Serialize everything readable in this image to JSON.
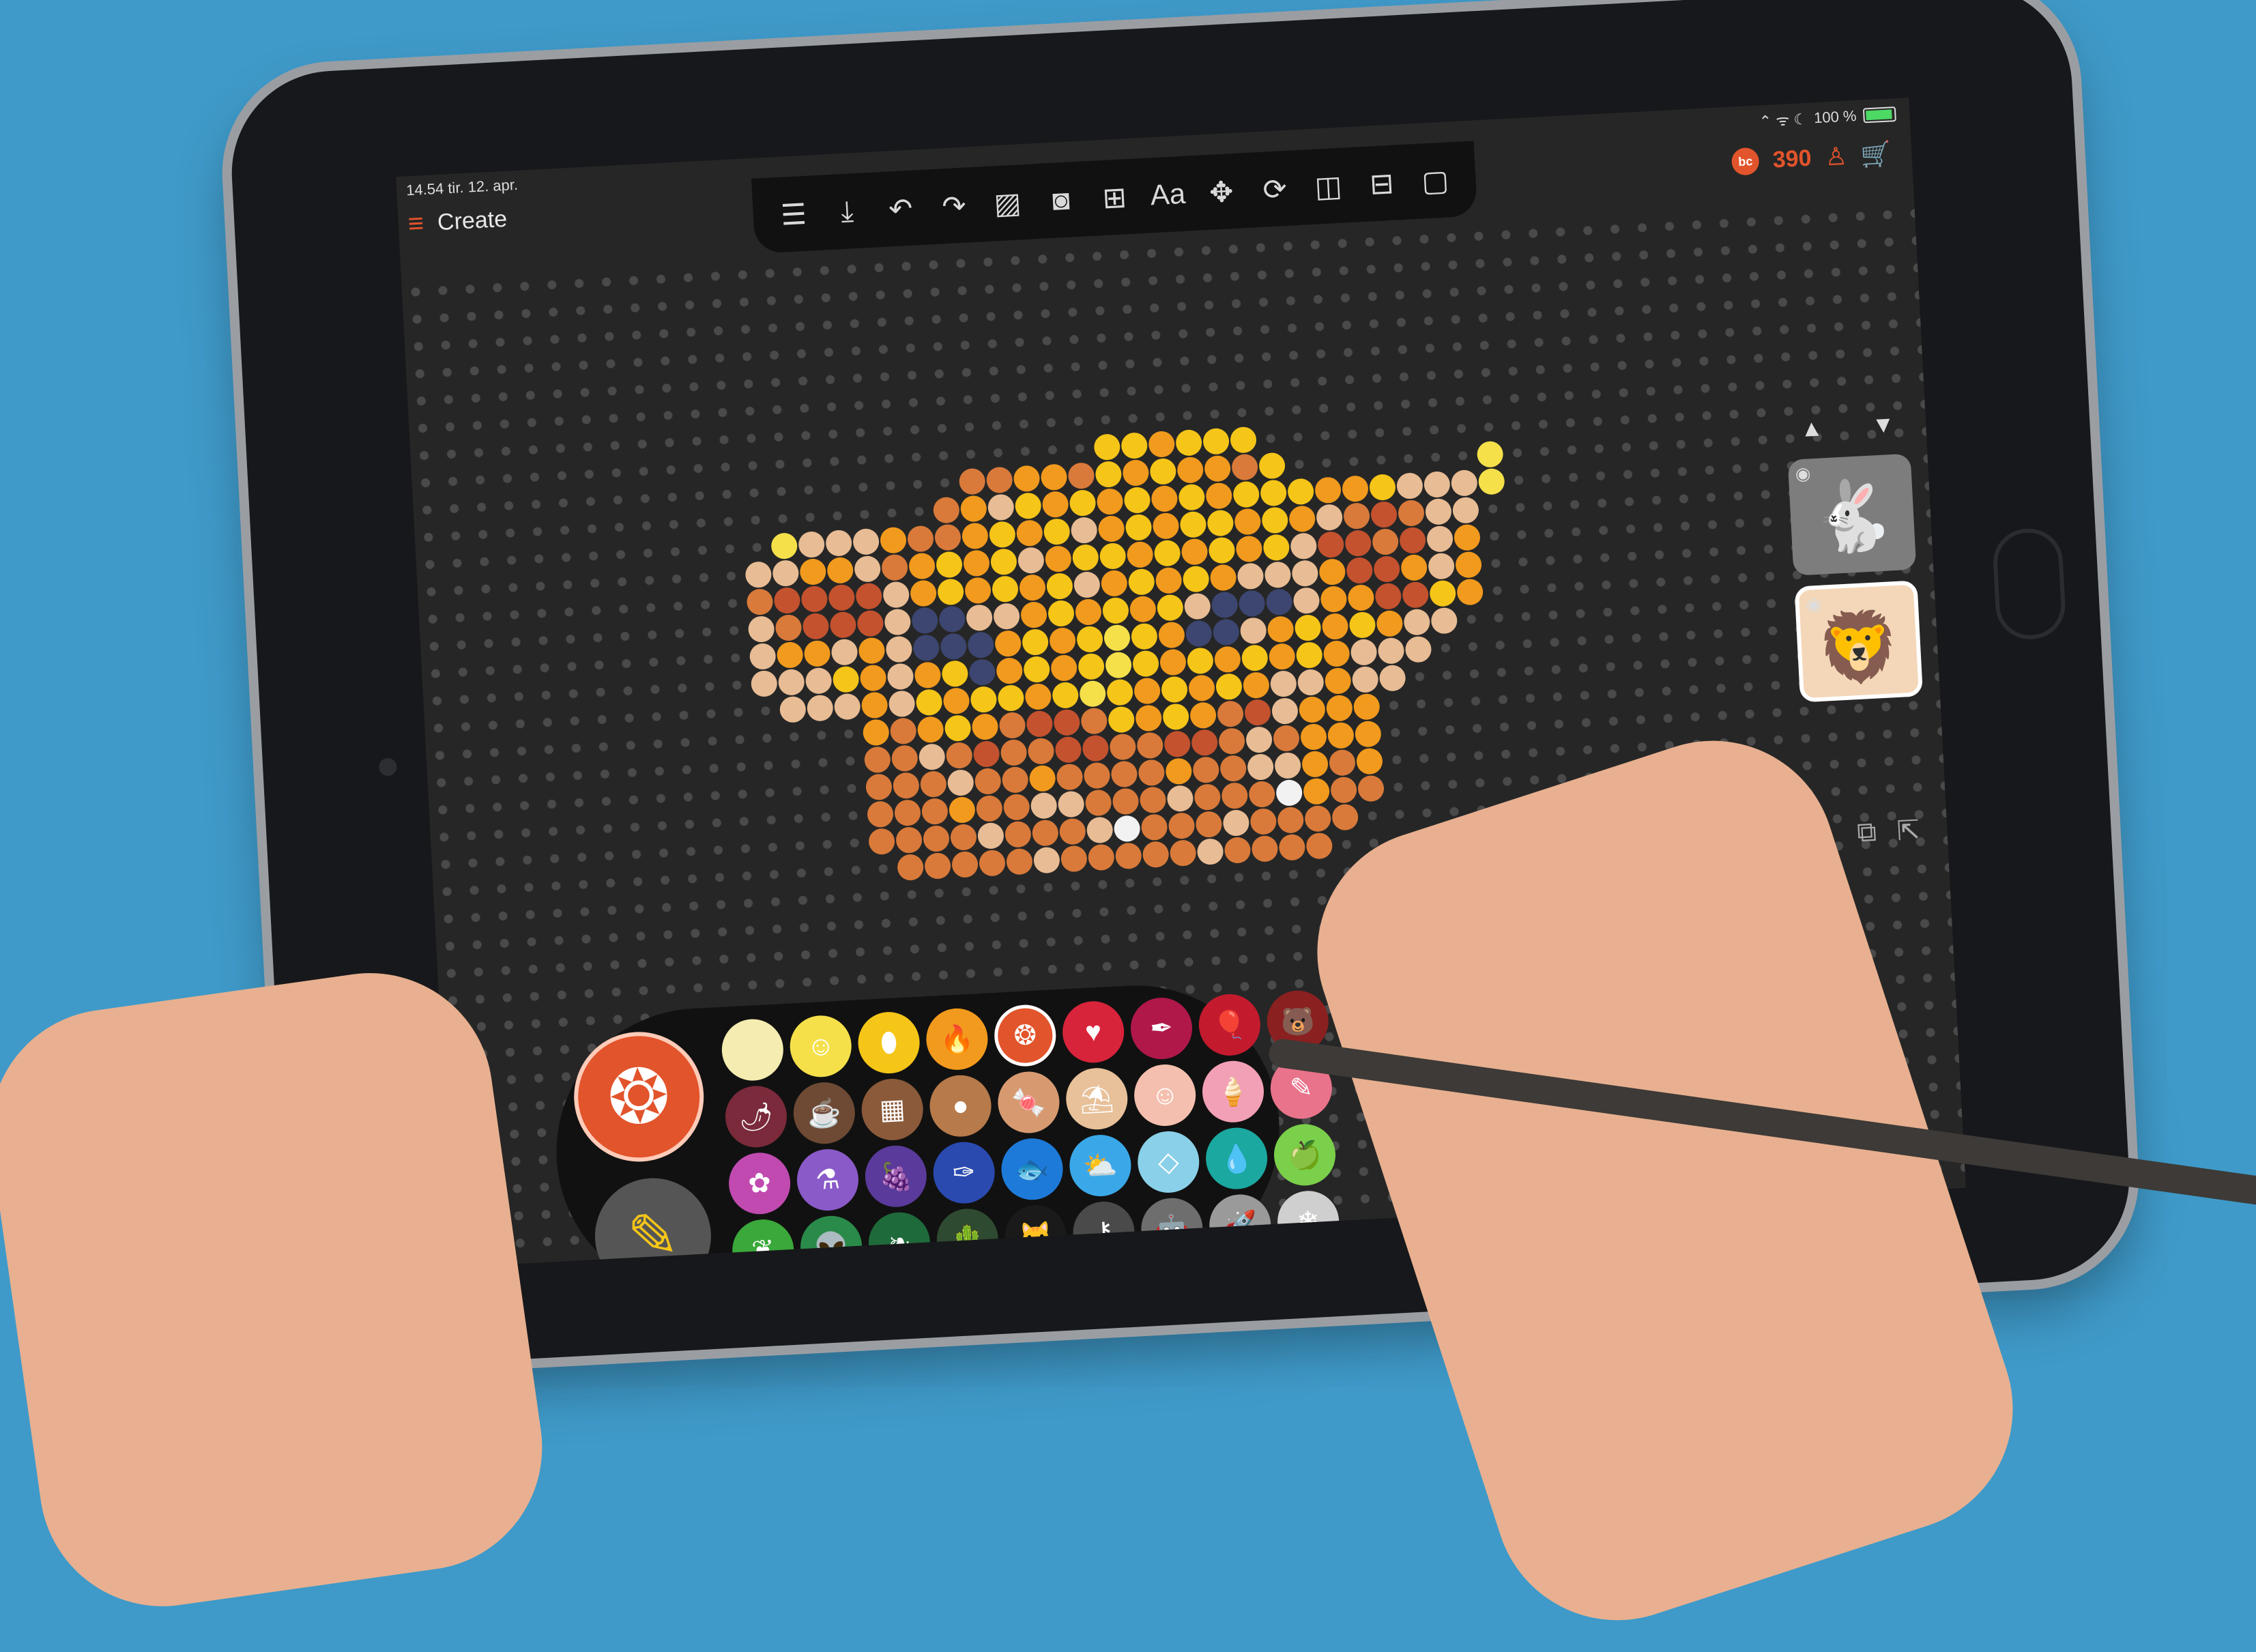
{
  "status": {
    "time": "14.54  tir. 12. apr.",
    "signal_icons": "⌃ ᯤ ☾",
    "battery_text": "100 %"
  },
  "app": {
    "menu_icon": "hamburger-icon",
    "title": "Create"
  },
  "toolbar": {
    "items": [
      {
        "name": "list-icon",
        "glyph": "☰"
      },
      {
        "name": "download-icon",
        "glyph": "⤓"
      },
      {
        "name": "undo-icon",
        "glyph": "↶"
      },
      {
        "name": "redo-icon",
        "glyph": "↷"
      },
      {
        "name": "image-icon",
        "glyph": "▨"
      },
      {
        "name": "camera-icon",
        "glyph": "◙"
      },
      {
        "name": "grid-icon",
        "glyph": "⊞"
      },
      {
        "name": "text-icon",
        "glyph": "Aa"
      },
      {
        "name": "move-icon",
        "glyph": "✥"
      },
      {
        "name": "rotate-icon",
        "glyph": "⟳"
      },
      {
        "name": "mirror-icon",
        "glyph": "◫"
      },
      {
        "name": "flip-icon",
        "glyph": "⊟"
      },
      {
        "name": "frame-icon",
        "glyph": "▢"
      }
    ]
  },
  "header": {
    "coin_badge": "bc",
    "coins": "390",
    "user_icon": "♙",
    "cart_icon": "🛒"
  },
  "layers": {
    "up_arrow": "▲",
    "down_arrow": "▼",
    "eye": "◉",
    "items": [
      {
        "name": "bunny",
        "glyph": "🐇"
      },
      {
        "name": "lion",
        "glyph": "🦁"
      }
    ]
  },
  "side_actions": {
    "duplicate": "⧉",
    "export": "⇱"
  },
  "palette": {
    "active_color": "#e2542b",
    "active_glyph": "❂",
    "pencil_glyph": "✎",
    "swatches": [
      {
        "color": "#f4ecb0",
        "glyph": "",
        "icon": "swatch-cream-icon"
      },
      {
        "color": "#f5e04a",
        "glyph": "☺",
        "icon": "swatch-lemon-icon"
      },
      {
        "color": "#f5c518",
        "glyph": "⬮",
        "icon": "swatch-banana-icon"
      },
      {
        "color": "#f29a1d",
        "glyph": "🔥",
        "icon": "swatch-fire-icon"
      },
      {
        "color": "#e2542b",
        "glyph": "❂",
        "icon": "swatch-orange-icon",
        "selected": true
      },
      {
        "color": "#d8243a",
        "glyph": "♥",
        "icon": "swatch-heart-icon"
      },
      {
        "color": "#b0184a",
        "glyph": "✒",
        "icon": "swatch-lipstick-icon"
      },
      {
        "color": "#c41a2e",
        "glyph": "🎈",
        "icon": "swatch-balloon-icon"
      },
      {
        "color": "#8a2020",
        "glyph": "🐻",
        "icon": "swatch-bear-icon"
      },
      {
        "color": "#7a2a3a",
        "glyph": "🌶",
        "icon": "swatch-radish-icon"
      },
      {
        "color": "#6e4a34",
        "glyph": "☕",
        "icon": "swatch-coffee-icon"
      },
      {
        "color": "#8b5a3a",
        "glyph": "▦",
        "icon": "swatch-chocolate-icon"
      },
      {
        "color": "#b77a4a",
        "glyph": "●",
        "icon": "swatch-cookie-icon"
      },
      {
        "color": "#d79a70",
        "glyph": "🍬",
        "icon": "swatch-candy-icon"
      },
      {
        "color": "#e8c19a",
        "glyph": "⛱",
        "icon": "swatch-sand-icon"
      },
      {
        "color": "#f4bfae",
        "glyph": "☺",
        "icon": "swatch-baby-icon"
      },
      {
        "color": "#f2a0b5",
        "glyph": "🍦",
        "icon": "swatch-icecream-icon"
      },
      {
        "color": "#e9738a",
        "glyph": "✎",
        "icon": "swatch-pink-icon"
      },
      {
        "color": "#c04ab0",
        "glyph": "✿",
        "icon": "swatch-flower-icon"
      },
      {
        "color": "#8a5ac8",
        "glyph": "⚗",
        "icon": "swatch-potion-icon"
      },
      {
        "color": "#5a3a9a",
        "glyph": "🍇",
        "icon": "swatch-grapes-icon"
      },
      {
        "color": "#2a4ab0",
        "glyph": "✑",
        "icon": "swatch-paint-icon"
      },
      {
        "color": "#1e7ad8",
        "glyph": "🐟",
        "icon": "swatch-fish-icon"
      },
      {
        "color": "#3aa8e8",
        "glyph": "⛅",
        "icon": "swatch-sky-icon"
      },
      {
        "color": "#8ad0e8",
        "glyph": "◇",
        "icon": "swatch-diamond-icon"
      },
      {
        "color": "#1aa8a0",
        "glyph": "💧",
        "icon": "swatch-drop-icon"
      },
      {
        "color": "#7ad04a",
        "glyph": "🍏",
        "icon": "swatch-apple-icon"
      },
      {
        "color": "#3aa83a",
        "glyph": "❦",
        "icon": "swatch-peas-icon"
      },
      {
        "color": "#2a8a4a",
        "glyph": "👽",
        "icon": "swatch-alien-icon"
      },
      {
        "color": "#1f6a3a",
        "glyph": "❧",
        "icon": "swatch-leaf-icon"
      },
      {
        "color": "#2e4a30",
        "glyph": "🌵",
        "icon": "swatch-cactus-icon"
      },
      {
        "color": "#1a1a1a",
        "glyph": "🐱",
        "icon": "swatch-cat-icon"
      },
      {
        "color": "#4a4a4a",
        "glyph": "⚷",
        "icon": "swatch-key-icon"
      },
      {
        "color": "#6e6e6e",
        "glyph": "🤖",
        "icon": "swatch-robot-icon"
      },
      {
        "color": "#9a9a9a",
        "glyph": "🚀",
        "icon": "swatch-rocket-icon"
      },
      {
        "color": "#cfcfcf",
        "glyph": "❄",
        "icon": "swatch-snow-icon"
      }
    ]
  },
  "bead_colors": {
    "D": "#d97a3a",
    "O": "#f29a1d",
    "Y": "#f5c518",
    "L": "#f5e04a",
    "P": "#e8bc94",
    "R": "#c4522e",
    "N": "#3c4670",
    "W": "#f2f2f2"
  },
  "bead_pattern": [
    "...............YYOYYY.................",
    "..........DDOODYOYOODY.......L.......",
    ".........DOPYOYOYOYOYYYOOYPPPL.......",
    "...LPPPODDOYOYPOYOYYOYOPDRDPP........",
    "..PPOOPDOYOYPOYYOYOYOYPRRDRPO........",
    "..DRRRRPOYOYOYPOYOYOPPPORROPO........",
    "..PDRRRPNNPPOYOYOYPNNNPOORRYO........",
    "..POOPOPNNNOYOYLYONNPOYOYOPP.........",
    "..PPPYOPOYNOYOYLYOYOYOYOPPP..........",
    "...PPPOPYOYYOYLYOYOYOPPOPP...........",
    "......ODOYODRRDYOYODRPOOO............",
    "......DDPDRDDRRDDRRDPDOOO............",
    "......DDDPDDODDDDODDPPODO............",
    "......DDDODDPPDDDPDDDWODD............",
    "......DDDDPDDDPWDDDPDDDD.............",
    ".......DDDDDPDDDDDPDDDD.............."
  ]
}
